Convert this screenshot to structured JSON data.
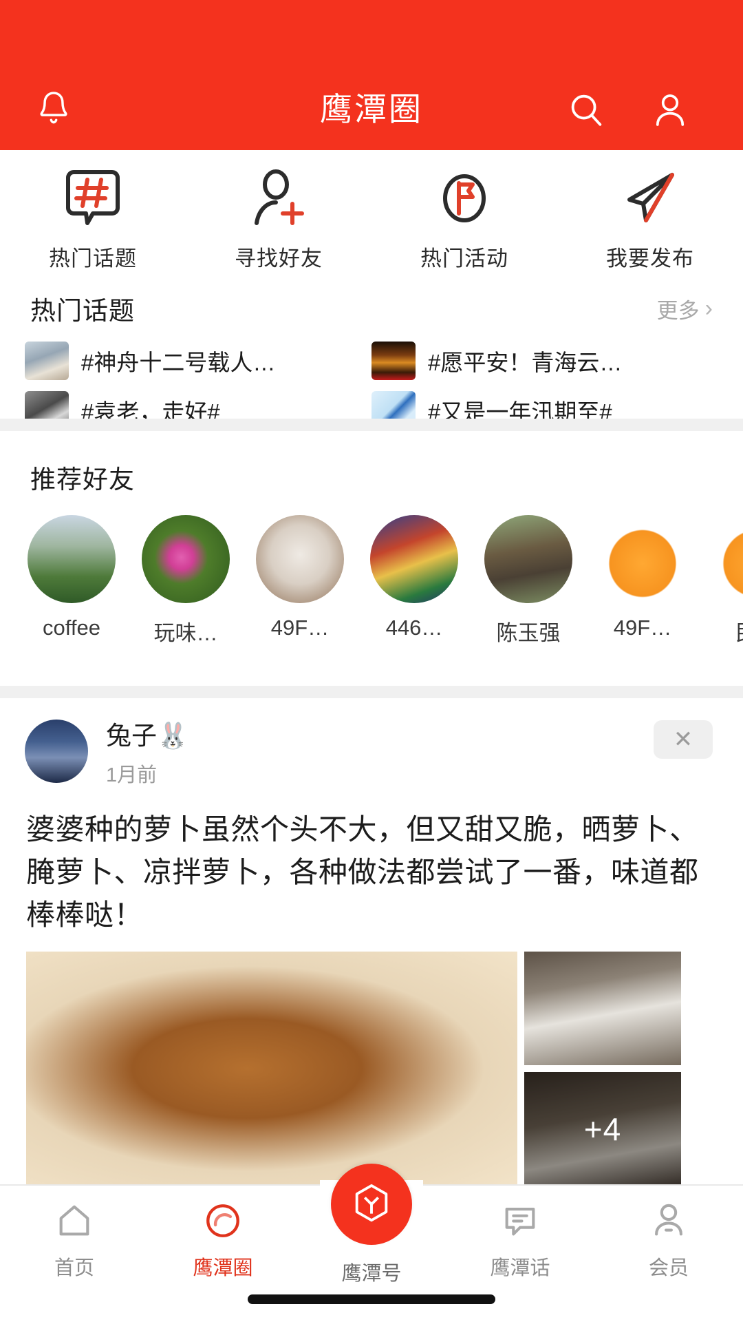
{
  "theme": {
    "primary": "#F4321E",
    "accent_red": "#E0331C",
    "text_dark": "#1c1c1c",
    "text_muted": "#9a9a9a"
  },
  "header": {
    "title": "鹰潭圈",
    "bell_icon": "bell-icon",
    "search_icon": "search-icon",
    "profile_icon": "user-icon"
  },
  "quick_actions": [
    {
      "label": "热门话题",
      "icon": "hashtag-bubble-icon"
    },
    {
      "label": "寻找好友",
      "icon": "person-add-icon"
    },
    {
      "label": "热门活动",
      "icon": "flag-circle-icon"
    },
    {
      "label": "我要发布",
      "icon": "paper-plane-icon"
    }
  ],
  "hot_topics": {
    "title": "热门话题",
    "more_label": "更多",
    "more_icon": "chevron-right-icon",
    "items": [
      {
        "text": "#神舟十二号载人…",
        "thumb": "ph-rocket"
      },
      {
        "text": "#愿平安！青海云…",
        "thumb": "ph-candle"
      },
      {
        "text": "#袁老，走好#",
        "thumb": "ph-yuan"
      },
      {
        "text": "#又是一年汛期至#",
        "thumb": "ph-flood"
      }
    ]
  },
  "recommended_friends": {
    "title": "推荐好友",
    "items": [
      {
        "name": "coffee",
        "avatar": "ph-field"
      },
      {
        "name": "玩味…",
        "avatar": "ph-flower"
      },
      {
        "name": "49F…",
        "avatar": "ph-ink"
      },
      {
        "name": "446…",
        "avatar": "ph-dance"
      },
      {
        "name": "陈玉强",
        "avatar": "ph-rock"
      },
      {
        "name": "49F…",
        "avatar": "ph-orange"
      },
      {
        "name": "民族",
        "avatar": "ph-orange"
      }
    ]
  },
  "post": {
    "author": "兔子🐰",
    "time": "1月前",
    "close_icon": "close-icon",
    "close_label": "✕",
    "avatar": "ph-lake",
    "text": "婆婆种的萝卜虽然个头不大，但又甜又脆，晒萝卜、腌萝卜、凉拌萝卜，各种做法都尝试了一番，味道都棒棒哒！",
    "images": [
      {
        "name": "main-photo",
        "style": "ph-dish"
      },
      {
        "name": "thumb-photo-1",
        "style": "ph-dry1"
      },
      {
        "name": "thumb-photo-2",
        "style": "ph-dry2",
        "overlay": "+4"
      }
    ],
    "more_count_label": "+4"
  },
  "tabbar": {
    "items": [
      {
        "label": "首页",
        "icon": "home-icon",
        "active": false
      },
      {
        "label": "鹰潭圈",
        "icon": "circle-ring-icon",
        "active": true
      },
      {
        "label": "鹰潭号",
        "icon": "hexagon-logo-icon",
        "active": false,
        "center": true
      },
      {
        "label": "鹰潭话",
        "icon": "chat-bubble-icon",
        "active": false
      },
      {
        "label": "会员",
        "icon": "member-user-icon",
        "active": false
      }
    ]
  }
}
